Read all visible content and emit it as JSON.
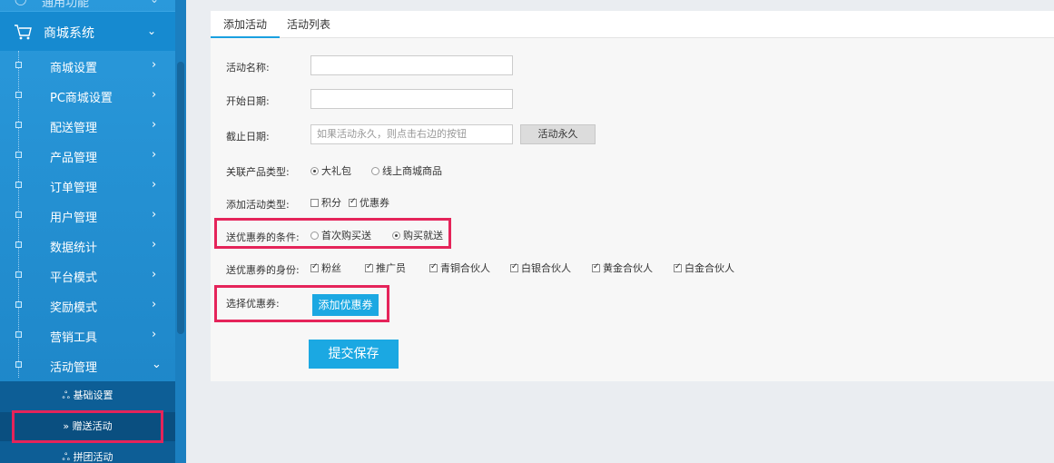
{
  "sidebar": {
    "cut_label": "通用功能",
    "main": {
      "label": "商城系统",
      "icon": "cart-icon"
    },
    "items": [
      {
        "label": "商城设置"
      },
      {
        "label": "PC商城设置"
      },
      {
        "label": "配送管理"
      },
      {
        "label": "产品管理"
      },
      {
        "label": "订单管理"
      },
      {
        "label": "用户管理"
      },
      {
        "label": "数据统计"
      },
      {
        "label": "平台模式"
      },
      {
        "label": "奖励模式"
      },
      {
        "label": "营销工具"
      },
      {
        "label": "活动管理"
      }
    ],
    "sub_items": [
      {
        "label": "基础设置",
        "icon": "users-icon"
      },
      {
        "label": "赠送活动",
        "icon": "double-chevron-icon"
      },
      {
        "label": "拼团活动",
        "icon": "users-icon"
      }
    ]
  },
  "tabs": [
    {
      "label": "添加活动"
    },
    {
      "label": "活动列表"
    }
  ],
  "form": {
    "name_label": "活动名称:",
    "name_value": "",
    "start_label": "开始日期:",
    "start_value": "",
    "end_label": "截止日期:",
    "end_placeholder": "如果活动永久，则点击右边的按钮",
    "forever_btn": "活动永久",
    "product_type_label": "关联产品类型:",
    "product_types": [
      {
        "label": "大礼包",
        "checked": true
      },
      {
        "label": "线上商城商品",
        "checked": false
      }
    ],
    "activity_type_label": "添加活动类型:",
    "activity_types": [
      {
        "label": "积分",
        "checked": false
      },
      {
        "label": "优惠券",
        "checked": true
      }
    ],
    "condition_label": "送优惠券的条件:",
    "conditions": [
      {
        "label": "首次购买送",
        "checked": false
      },
      {
        "label": "购买就送",
        "checked": true
      }
    ],
    "identity_label": "送优惠券的身份:",
    "identities": [
      {
        "label": "粉丝",
        "checked": true
      },
      {
        "label": "推广员",
        "checked": true
      },
      {
        "label": "青铜合伙人",
        "checked": true
      },
      {
        "label": "白银合伙人",
        "checked": true
      },
      {
        "label": "黄金合伙人",
        "checked": true
      },
      {
        "label": "白金合伙人",
        "checked": true
      }
    ],
    "coupon_label": "选择优惠券:",
    "add_coupon_btn": "添加优惠券",
    "submit_btn": "提交保存"
  },
  "colors": {
    "accent": "#1ba8e2",
    "highlight": "#e5245a",
    "sidebar": "#1c8ccf"
  }
}
